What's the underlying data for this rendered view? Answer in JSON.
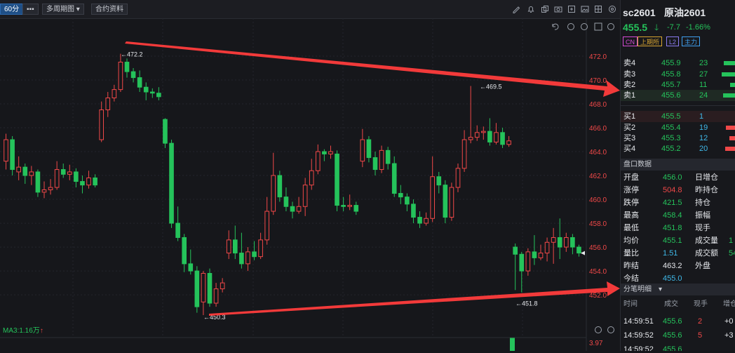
{
  "toolbar": {
    "period": "60分",
    "more": "▪▪▪",
    "multi_period": "多周期图",
    "contract_info": "合约资料"
  },
  "chart_data": {
    "type": "candlestick",
    "y_ticks": [
      "472.0",
      "470.0",
      "468.0",
      "466.0",
      "464.0",
      "462.0",
      "460.0",
      "458.0",
      "456.0",
      "454.0",
      "452.0"
    ],
    "ylim": [
      450.3,
      473.0
    ],
    "high_label": "472.2",
    "low_label": "450.3",
    "mid_high_label": "469.5",
    "mid_low_label": "451.8",
    "last_price_marker": 455.5,
    "candles": [
      {
        "o": 463.2,
        "c": 465.0,
        "h": 465.5,
        "l": 462.5
      },
      {
        "o": 465.0,
        "c": 462.5,
        "h": 465.3,
        "l": 462.0
      },
      {
        "o": 462.3,
        "c": 462.7,
        "h": 463.6,
        "l": 461.6
      },
      {
        "o": 462.7,
        "c": 462.0,
        "h": 463.0,
        "l": 461.3
      },
      {
        "o": 462.0,
        "c": 462.3,
        "h": 462.8,
        "l": 461.2
      },
      {
        "o": 462.3,
        "c": 460.6,
        "h": 462.5,
        "l": 460.2
      },
      {
        "o": 460.6,
        "c": 460.8,
        "h": 461.5,
        "l": 460.1
      },
      {
        "o": 460.8,
        "c": 461.0,
        "h": 461.7,
        "l": 460.4
      },
      {
        "o": 461.0,
        "c": 462.5,
        "h": 463.2,
        "l": 460.8
      },
      {
        "o": 462.5,
        "c": 462.1,
        "h": 463.0,
        "l": 461.8
      },
      {
        "o": 462.1,
        "c": 462.3,
        "h": 462.9,
        "l": 461.6
      },
      {
        "o": 462.3,
        "c": 461.5,
        "h": 462.6,
        "l": 461.0
      },
      {
        "o": 461.5,
        "c": 461.2,
        "h": 462.0,
        "l": 460.5
      },
      {
        "o": 461.2,
        "c": 461.8,
        "h": 462.4,
        "l": 460.9
      },
      {
        "o": 461.8,
        "c": 461.2,
        "h": 462.1,
        "l": 461.0
      },
      {
        "o": 465.0,
        "c": 467.5,
        "h": 468.2,
        "l": 464.8
      },
      {
        "o": 467.5,
        "c": 468.5,
        "h": 469.0,
        "l": 466.9
      },
      {
        "o": 468.5,
        "c": 469.2,
        "h": 469.6,
        "l": 468.2
      },
      {
        "o": 469.2,
        "c": 471.5,
        "h": 472.2,
        "l": 469.0
      },
      {
        "o": 471.5,
        "c": 470.7,
        "h": 471.8,
        "l": 470.2
      },
      {
        "o": 470.7,
        "c": 470.2,
        "h": 471.0,
        "l": 469.8
      },
      {
        "o": 470.2,
        "c": 469.4,
        "h": 470.8,
        "l": 469.0
      },
      {
        "o": 469.4,
        "c": 469.0,
        "h": 469.8,
        "l": 468.3
      },
      {
        "o": 469.0,
        "c": 468.9,
        "h": 469.3,
        "l": 468.5
      },
      {
        "o": 468.9,
        "c": 468.6,
        "h": 469.4,
        "l": 468.3
      },
      {
        "o": 466.7,
        "c": 464.7,
        "h": 466.8,
        "l": 464.3
      },
      {
        "o": 464.7,
        "c": 458.0,
        "h": 465.0,
        "l": 457.6
      },
      {
        "o": 458.0,
        "c": 456.8,
        "h": 459.4,
        "l": 456.5
      },
      {
        "o": 456.8,
        "c": 454.6,
        "h": 457.1,
        "l": 453.9
      },
      {
        "o": 454.6,
        "c": 454.0,
        "h": 455.8,
        "l": 453.7
      },
      {
        "o": 454.0,
        "c": 451.0,
        "h": 454.4,
        "l": 450.5
      },
      {
        "o": 451.4,
        "c": 453.8,
        "h": 454.0,
        "l": 450.3
      },
      {
        "o": 453.8,
        "c": 451.3,
        "h": 454.2,
        "l": 451.0
      },
      {
        "o": 451.3,
        "c": 452.5,
        "h": 453.0,
        "l": 451.0
      },
      {
        "o": 452.5,
        "c": 453.0,
        "h": 453.4,
        "l": 452.2
      },
      {
        "o": 455.5,
        "c": 456.6,
        "h": 457.4,
        "l": 455.0
      },
      {
        "o": 456.6,
        "c": 455.5,
        "h": 457.8,
        "l": 455.0
      },
      {
        "o": 455.5,
        "c": 454.6,
        "h": 457.2,
        "l": 454.2
      },
      {
        "o": 454.6,
        "c": 455.6,
        "h": 456.0,
        "l": 454.0
      },
      {
        "o": 455.6,
        "c": 455.2,
        "h": 456.5,
        "l": 454.9
      },
      {
        "o": 455.2,
        "c": 456.6,
        "h": 457.2,
        "l": 455.0
      },
      {
        "o": 456.6,
        "c": 459.0,
        "h": 460.2,
        "l": 456.2
      },
      {
        "o": 459.0,
        "c": 462.0,
        "h": 463.9,
        "l": 458.7
      },
      {
        "o": 462.0,
        "c": 460.2,
        "h": 462.4,
        "l": 459.8
      },
      {
        "o": 460.2,
        "c": 459.4,
        "h": 461.0,
        "l": 459.0
      },
      {
        "o": 459.4,
        "c": 459.0,
        "h": 459.8,
        "l": 458.4
      },
      {
        "o": 459.0,
        "c": 459.4,
        "h": 460.2,
        "l": 458.8
      },
      {
        "o": 459.4,
        "c": 461.2,
        "h": 461.8,
        "l": 458.6
      },
      {
        "o": 461.2,
        "c": 462.4,
        "h": 463.4,
        "l": 460.8
      },
      {
        "o": 462.4,
        "c": 464.0,
        "h": 464.6,
        "l": 462.1
      },
      {
        "o": 464.0,
        "c": 463.8,
        "h": 464.2,
        "l": 463.2
      },
      {
        "o": 463.8,
        "c": 464.0,
        "h": 464.5,
        "l": 463.4
      },
      {
        "o": 463.8,
        "c": 459.5,
        "h": 464.1,
        "l": 459.0
      },
      {
        "o": 459.5,
        "c": 459.4,
        "h": 460.2,
        "l": 459.0
      },
      {
        "o": 459.4,
        "c": 459.5,
        "h": 460.4,
        "l": 459.1
      },
      {
        "o": 459.5,
        "c": 459.0,
        "h": 459.8,
        "l": 458.7
      },
      {
        "o": 463.2,
        "c": 465.0,
        "h": 465.9,
        "l": 462.7
      },
      {
        "o": 465.0,
        "c": 463.5,
        "h": 465.3,
        "l": 463.1
      },
      {
        "o": 463.5,
        "c": 462.5,
        "h": 464.0,
        "l": 462.0
      },
      {
        "o": 462.5,
        "c": 464.1,
        "h": 464.5,
        "l": 462.2
      },
      {
        "o": 464.1,
        "c": 463.0,
        "h": 464.4,
        "l": 462.5
      },
      {
        "o": 463.0,
        "c": 460.5,
        "h": 463.6,
        "l": 460.2
      },
      {
        "o": 460.5,
        "c": 460.2,
        "h": 461.2,
        "l": 459.6
      },
      {
        "o": 460.2,
        "c": 459.6,
        "h": 460.5,
        "l": 459.0
      },
      {
        "o": 459.6,
        "c": 458.5,
        "h": 460.0,
        "l": 458.0
      },
      {
        "o": 458.5,
        "c": 458.0,
        "h": 459.0,
        "l": 457.6
      },
      {
        "o": 458.0,
        "c": 458.4,
        "h": 458.9,
        "l": 457.8
      },
      {
        "o": 458.4,
        "c": 461.9,
        "h": 463.6,
        "l": 458.1
      },
      {
        "o": 461.9,
        "c": 461.2,
        "h": 462.3,
        "l": 460.5
      },
      {
        "o": 461.2,
        "c": 458.5,
        "h": 461.6,
        "l": 458.0
      },
      {
        "o": 458.5,
        "c": 461.0,
        "h": 461.4,
        "l": 458.2
      },
      {
        "o": 461.0,
        "c": 462.6,
        "h": 463.0,
        "l": 460.6
      },
      {
        "o": 462.6,
        "c": 465.0,
        "h": 465.8,
        "l": 462.3
      },
      {
        "o": 465.0,
        "c": 465.2,
        "h": 469.5,
        "l": 464.7
      },
      {
        "o": 465.2,
        "c": 465.6,
        "h": 466.2,
        "l": 464.9
      },
      {
        "o": 465.6,
        "c": 465.7,
        "h": 466.1,
        "l": 465.0
      },
      {
        "o": 465.7,
        "c": 464.8,
        "h": 466.8,
        "l": 464.5
      },
      {
        "o": 464.8,
        "c": 465.6,
        "h": 466.4,
        "l": 464.6
      },
      {
        "o": 465.6,
        "c": 464.6,
        "h": 466.0,
        "l": 464.3
      },
      {
        "o": 464.6,
        "c": 464.9,
        "h": 465.3,
        "l": 464.4
      },
      {
        "o": 456.0,
        "c": 455.4,
        "h": 456.3,
        "l": 452.4
      },
      {
        "o": 455.4,
        "c": 454.0,
        "h": 455.6,
        "l": 452.2
      },
      {
        "o": 454.0,
        "c": 455.6,
        "h": 455.9,
        "l": 453.6
      },
      {
        "o": 455.6,
        "c": 455.1,
        "h": 457.0,
        "l": 454.5
      },
      {
        "o": 455.1,
        "c": 455.5,
        "h": 456.2,
        "l": 454.9
      },
      {
        "o": 455.5,
        "c": 456.4,
        "h": 456.8,
        "l": 454.8
      },
      {
        "o": 456.4,
        "c": 456.8,
        "h": 457.6,
        "l": 454.6
      },
      {
        "o": 456.8,
        "c": 456.0,
        "h": 458.4,
        "l": 455.0
      },
      {
        "o": 456.0,
        "c": 456.8,
        "h": 457.2,
        "l": 455.6
      },
      {
        "o": 456.8,
        "c": 456.0,
        "h": 457.1,
        "l": 455.4
      },
      {
        "o": 456.0,
        "c": 455.5,
        "h": 456.2,
        "l": 455.2
      }
    ]
  },
  "indicator": {
    "label": "MA3:1.16万",
    "arrow": "↑",
    "tick": "3.97"
  },
  "header": {
    "code": "sc2601",
    "name": "原油2601"
  },
  "quote": {
    "price": "455.5",
    "change": "-7.7",
    "pct": "-1.66%"
  },
  "tags": [
    "CN",
    "上期所",
    "L2",
    "主力"
  ],
  "asks": [
    {
      "label": "卖4",
      "price": "455.9",
      "vol": "23",
      "bar": 0.85
    },
    {
      "label": "卖3",
      "price": "455.8",
      "vol": "27",
      "bar": 1.0
    },
    {
      "label": "卖2",
      "price": "455.7",
      "vol": "11",
      "bar": 0.4
    },
    {
      "label": "卖1",
      "price": "455.6",
      "vol": "24",
      "bar": 0.9
    }
  ],
  "bids": [
    {
      "label": "买1",
      "price": "455.5",
      "vol": "1",
      "bar": 0.05
    },
    {
      "label": "买2",
      "price": "455.4",
      "vol": "19",
      "bar": 0.7
    },
    {
      "label": "买3",
      "price": "455.3",
      "vol": "12",
      "bar": 0.45
    },
    {
      "label": "买4",
      "price": "455.2",
      "vol": "20",
      "bar": 0.75
    }
  ],
  "panel_title": "盘口数据",
  "stats": [
    {
      "k": "开盘",
      "v": "456.0",
      "c": "green",
      "k2": "日增仓"
    },
    {
      "k": "涨停",
      "v": "504.8",
      "c": "red",
      "k2": "昨持仓"
    },
    {
      "k": "跌停",
      "v": "421.5",
      "c": "green",
      "k2": "持仓"
    },
    {
      "k": "最高",
      "v": "458.4",
      "c": "green",
      "k2": "振幅"
    },
    {
      "k": "最低",
      "v": "451.8",
      "c": "green",
      "k2": "现手"
    },
    {
      "k": "均价",
      "v": "455.1",
      "c": "green",
      "k2": "成交量"
    },
    {
      "k": "量比",
      "v": "1.51",
      "c": "cyan",
      "k2": "成交额"
    },
    {
      "k": "昨结",
      "v": "463.2",
      "c": "white",
      "k2": "外盘"
    },
    {
      "k": "今结",
      "v": "455.0",
      "c": "cyan",
      "k2": ""
    }
  ],
  "stats_partial": [
    "",
    "",
    "",
    "",
    "",
    "1",
    "54",
    "",
    ""
  ],
  "ticks_title": "分笔明细",
  "ticks_cols": [
    "时间",
    "成交",
    "现手",
    "增仓"
  ],
  "ticks": [
    {
      "t": "14:59:51",
      "p": "455.6",
      "v": "2",
      "d": "+0"
    },
    {
      "t": "14:59:52",
      "p": "455.6",
      "v": "5",
      "d": "+3"
    },
    {
      "t": "14:59:52",
      "p": "455.6",
      "v": "",
      "d": ""
    }
  ]
}
